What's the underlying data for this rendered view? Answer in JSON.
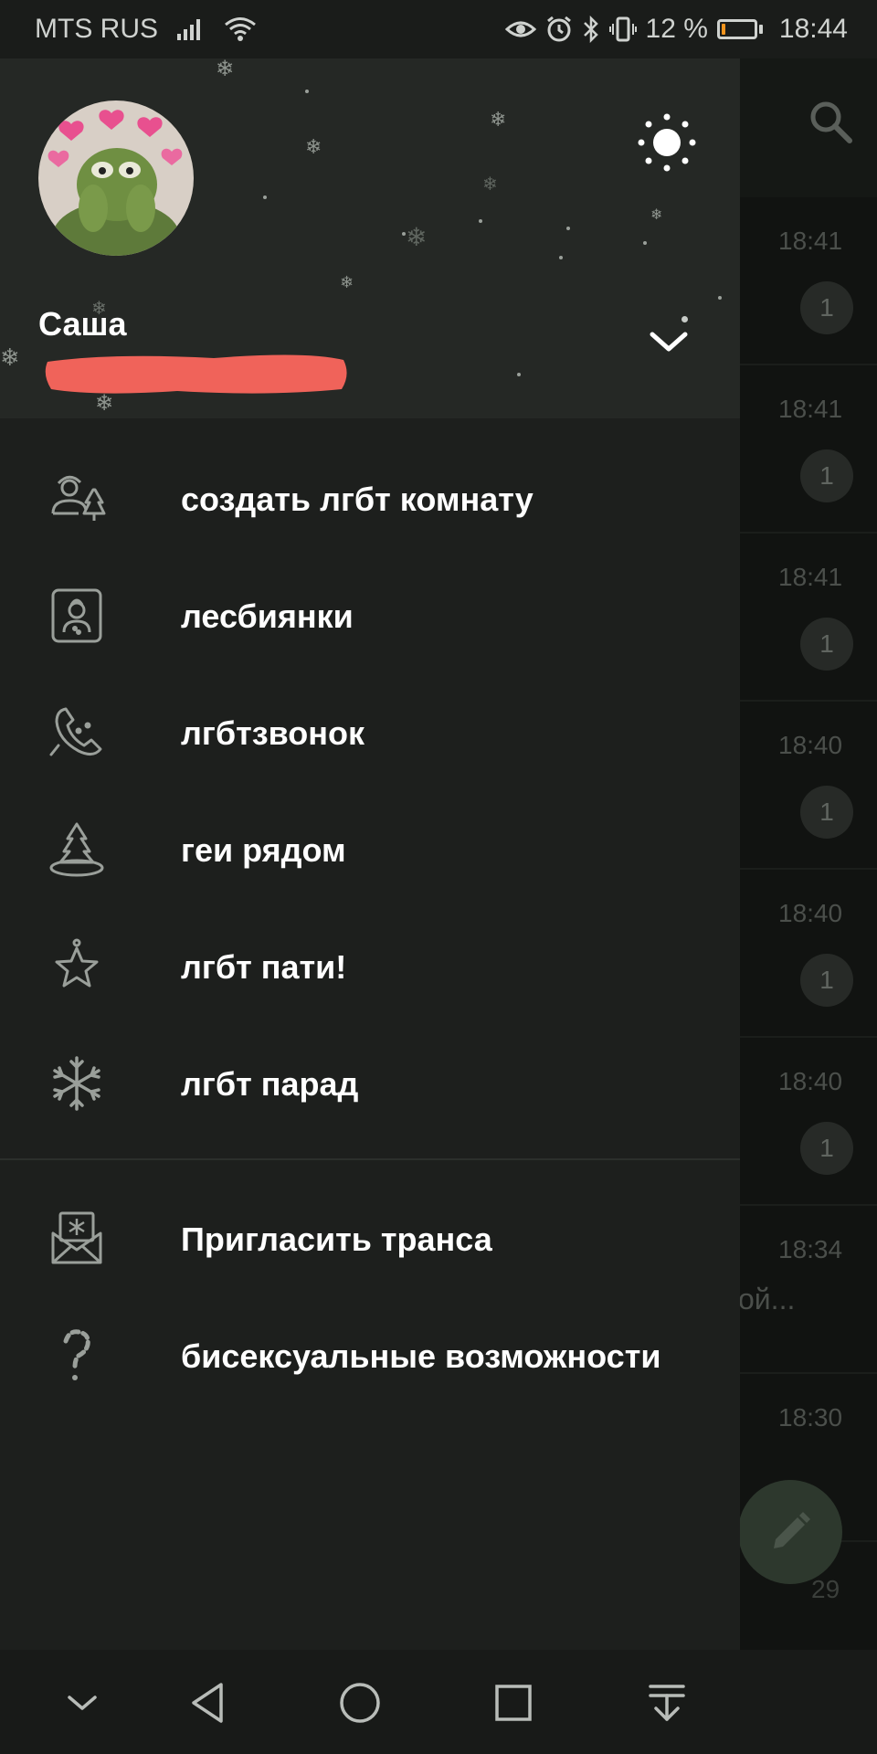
{
  "status_bar": {
    "carrier": "MTS RUS",
    "battery_percent": "12 %",
    "battery_level": 0.12,
    "time": "18:44",
    "accent_color": "#f2951e"
  },
  "chat_list": {
    "rows": [
      {
        "time": "18:41",
        "badge": "1"
      },
      {
        "time": "18:41",
        "badge": "1"
      },
      {
        "time": "18:41",
        "badge": "1"
      },
      {
        "time": "18:40",
        "badge": "1"
      },
      {
        "time": "18:40",
        "badge": "1"
      },
      {
        "time": "18:40",
        "badge": "1"
      },
      {
        "time": "18:34",
        "preview": "ой..."
      },
      {
        "time": "18:30"
      }
    ],
    "peek_text": "29"
  },
  "drawer": {
    "user_name": "Саша",
    "menu": [
      {
        "label": "создать лгбт комнату",
        "icon": "new-group-icon"
      },
      {
        "label": "лесбиянки",
        "icon": "contacts-icon"
      },
      {
        "label": "лгбтзвонок",
        "icon": "phone-icon"
      },
      {
        "label": "геи рядом",
        "icon": "people-nearby-icon"
      },
      {
        "label": "лгбт пати!",
        "icon": "star-icon"
      },
      {
        "label": "лгбт парад",
        "icon": "snowflake-icon"
      }
    ],
    "secondary_menu": [
      {
        "label": "Пригласить транса",
        "icon": "invite-icon"
      },
      {
        "label": "бисексуальные возможности",
        "icon": "help-icon"
      }
    ]
  },
  "colors": {
    "drawer_bg": "#1d1f1d",
    "header_bg": "#252825",
    "redaction": "#f0635a",
    "fab": "#2d382d"
  }
}
